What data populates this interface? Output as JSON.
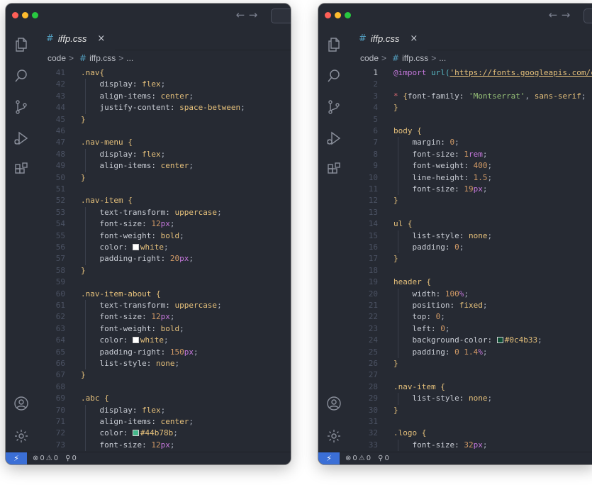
{
  "colors": {
    "window_bg": "#262a33",
    "remote_badge": "#3b6fd6",
    "selector": "#e5c07b",
    "number": "#d19a66",
    "unit": "#c678dd",
    "line_number": "#4b5263"
  },
  "nav": {
    "back": "←",
    "forward": "→"
  },
  "tab": {
    "icon": "#",
    "name": "iffp.css",
    "close": "×"
  },
  "breadcrumb": {
    "folder": "code",
    "sep": ">",
    "icon": "#",
    "file": "iffp.css",
    "tail": "..."
  },
  "activity_bar": [
    "explorer-icon",
    "search-icon",
    "source-control-icon",
    "run-debug-icon",
    "extensions-icon",
    "account-icon",
    "settings-gear-icon"
  ],
  "status": {
    "remote": "⚡",
    "errors_icon": "⊗",
    "errors": "0",
    "warnings_icon": "⚠",
    "warnings": "0",
    "ports_icon": "⚲",
    "ports": "0"
  },
  "windows": [
    {
      "lines": [
        {
          "n": "41",
          "t": [
            [
              "sel",
              ".nav{"
            ]
          ]
        },
        {
          "n": "42",
          "t": [
            [
              "prop",
              "    display: "
            ],
            [
              "val",
              "flex"
            ],
            [
              "punc",
              ";"
            ]
          ]
        },
        {
          "n": "43",
          "t": [
            [
              "prop",
              "    align-items: "
            ],
            [
              "val",
              "center"
            ],
            [
              "punc",
              ";"
            ]
          ]
        },
        {
          "n": "44",
          "t": [
            [
              "prop",
              "    justify-content: "
            ],
            [
              "val",
              "space-between"
            ],
            [
              "punc",
              ";"
            ]
          ]
        },
        {
          "n": "45",
          "t": [
            [
              "sel",
              "}"
            ]
          ]
        },
        {
          "n": "46",
          "t": []
        },
        {
          "n": "47",
          "t": [
            [
              "sel",
              ".nav-menu {"
            ]
          ]
        },
        {
          "n": "48",
          "t": [
            [
              "prop",
              "    display: "
            ],
            [
              "val",
              "flex"
            ],
            [
              "punc",
              ";"
            ]
          ]
        },
        {
          "n": "49",
          "t": [
            [
              "prop",
              "    align-items: "
            ],
            [
              "val",
              "center"
            ],
            [
              "punc",
              ";"
            ]
          ]
        },
        {
          "n": "50",
          "t": [
            [
              "sel",
              "}"
            ]
          ]
        },
        {
          "n": "51",
          "t": []
        },
        {
          "n": "52",
          "t": [
            [
              "sel",
              ".nav-item {"
            ]
          ]
        },
        {
          "n": "53",
          "t": [
            [
              "prop",
              "    text-transform: "
            ],
            [
              "val",
              "uppercase"
            ],
            [
              "punc",
              ";"
            ]
          ]
        },
        {
          "n": "54",
          "t": [
            [
              "prop",
              "    font-size: "
            ],
            [
              "num",
              "12"
            ],
            [
              "unit",
              "px"
            ],
            [
              "punc",
              ";"
            ]
          ]
        },
        {
          "n": "55",
          "t": [
            [
              "prop",
              "    font-weight: "
            ],
            [
              "val",
              "bold"
            ],
            [
              "punc",
              ";"
            ]
          ]
        },
        {
          "n": "56",
          "t": [
            [
              "prop",
              "    color: "
            ],
            [
              "swatch",
              "#ffffff"
            ],
            [
              "val",
              "white"
            ],
            [
              "punc",
              ";"
            ]
          ]
        },
        {
          "n": "57",
          "t": [
            [
              "prop",
              "    padding-right: "
            ],
            [
              "num",
              "20"
            ],
            [
              "unit",
              "px"
            ],
            [
              "punc",
              ";"
            ]
          ]
        },
        {
          "n": "58",
          "t": [
            [
              "sel",
              "}"
            ]
          ]
        },
        {
          "n": "59",
          "t": []
        },
        {
          "n": "60",
          "t": [
            [
              "sel",
              ".nav-item-about {"
            ]
          ]
        },
        {
          "n": "61",
          "t": [
            [
              "prop",
              "    text-transform: "
            ],
            [
              "val",
              "uppercase"
            ],
            [
              "punc",
              ";"
            ]
          ]
        },
        {
          "n": "62",
          "t": [
            [
              "prop",
              "    font-size: "
            ],
            [
              "num",
              "12"
            ],
            [
              "unit",
              "px"
            ],
            [
              "punc",
              ";"
            ]
          ]
        },
        {
          "n": "63",
          "t": [
            [
              "prop",
              "    font-weight: "
            ],
            [
              "val",
              "bold"
            ],
            [
              "punc",
              ";"
            ]
          ]
        },
        {
          "n": "64",
          "t": [
            [
              "prop",
              "    color: "
            ],
            [
              "swatch",
              "#ffffff"
            ],
            [
              "val",
              "white"
            ],
            [
              "punc",
              ";"
            ]
          ]
        },
        {
          "n": "65",
          "t": [
            [
              "prop",
              "    padding-right: "
            ],
            [
              "num",
              "150"
            ],
            [
              "unit",
              "px"
            ],
            [
              "punc",
              ";"
            ]
          ]
        },
        {
          "n": "66",
          "t": [
            [
              "prop",
              "    list-style: "
            ],
            [
              "val",
              "none"
            ],
            [
              "punc",
              ";"
            ]
          ]
        },
        {
          "n": "67",
          "t": [
            [
              "sel",
              "}"
            ]
          ]
        },
        {
          "n": "68",
          "t": []
        },
        {
          "n": "69",
          "t": [
            [
              "sel",
              ".abc {"
            ]
          ]
        },
        {
          "n": "70",
          "t": [
            [
              "prop",
              "    display: "
            ],
            [
              "val",
              "flex"
            ],
            [
              "punc",
              ";"
            ]
          ]
        },
        {
          "n": "71",
          "t": [
            [
              "prop",
              "    align-items: "
            ],
            [
              "val",
              "center"
            ],
            [
              "punc",
              ";"
            ]
          ]
        },
        {
          "n": "72",
          "t": [
            [
              "prop",
              "    color: "
            ],
            [
              "swatch",
              "#44b78b"
            ],
            [
              "val",
              "#44b78b"
            ],
            [
              "punc",
              ";"
            ]
          ]
        },
        {
          "n": "73",
          "t": [
            [
              "prop",
              "    font-size: "
            ],
            [
              "num",
              "12"
            ],
            [
              "unit",
              "px"
            ],
            [
              "punc",
              ";"
            ]
          ]
        }
      ]
    },
    {
      "lines": [
        {
          "n": "1",
          "active": true,
          "t": [
            [
              "at",
              "@import "
            ],
            [
              "fn",
              "url("
            ],
            [
              "url",
              "'https://fonts.googleapis.com/c"
            ]
          ]
        },
        {
          "n": "2",
          "t": []
        },
        {
          "n": "3",
          "t": [
            [
              "star",
              "* "
            ],
            [
              "sel",
              "{"
            ],
            [
              "prop",
              "font-family: "
            ],
            [
              "str",
              "'Montserrat'"
            ],
            [
              "punc",
              ", "
            ],
            [
              "val",
              "sans-serif"
            ],
            [
              "punc",
              ";"
            ]
          ]
        },
        {
          "n": "4",
          "t": [
            [
              "sel",
              "}"
            ]
          ]
        },
        {
          "n": "5",
          "t": []
        },
        {
          "n": "6",
          "t": [
            [
              "sel",
              "body {"
            ]
          ]
        },
        {
          "n": "7",
          "t": [
            [
              "prop",
              "    margin: "
            ],
            [
              "num",
              "0"
            ],
            [
              "punc",
              ";"
            ]
          ]
        },
        {
          "n": "8",
          "t": [
            [
              "prop",
              "    font-size: "
            ],
            [
              "num",
              "1"
            ],
            [
              "unit",
              "rem"
            ],
            [
              "punc",
              ";"
            ]
          ]
        },
        {
          "n": "9",
          "t": [
            [
              "prop",
              "    font-weight: "
            ],
            [
              "num",
              "400"
            ],
            [
              "punc",
              ";"
            ]
          ]
        },
        {
          "n": "10",
          "t": [
            [
              "prop",
              "    line-height: "
            ],
            [
              "num",
              "1.5"
            ],
            [
              "punc",
              ";"
            ]
          ]
        },
        {
          "n": "11",
          "t": [
            [
              "prop",
              "    font-size: "
            ],
            [
              "num",
              "19"
            ],
            [
              "unit",
              "px"
            ],
            [
              "punc",
              ";"
            ]
          ]
        },
        {
          "n": "12",
          "t": [
            [
              "sel",
              "}"
            ]
          ]
        },
        {
          "n": "13",
          "t": []
        },
        {
          "n": "14",
          "t": [
            [
              "sel",
              "ul {"
            ]
          ]
        },
        {
          "n": "15",
          "t": [
            [
              "prop",
              "    list-style: "
            ],
            [
              "val",
              "none"
            ],
            [
              "punc",
              ";"
            ]
          ]
        },
        {
          "n": "16",
          "t": [
            [
              "prop",
              "    padding: "
            ],
            [
              "num",
              "0"
            ],
            [
              "punc",
              ";"
            ]
          ]
        },
        {
          "n": "17",
          "t": [
            [
              "sel",
              "}"
            ]
          ]
        },
        {
          "n": "18",
          "t": []
        },
        {
          "n": "19",
          "t": [
            [
              "sel",
              "header {"
            ]
          ]
        },
        {
          "n": "20",
          "t": [
            [
              "prop",
              "    width: "
            ],
            [
              "num",
              "100"
            ],
            [
              "unit",
              "%"
            ],
            [
              "punc",
              ";"
            ]
          ]
        },
        {
          "n": "21",
          "t": [
            [
              "prop",
              "    position: "
            ],
            [
              "val",
              "fixed"
            ],
            [
              "punc",
              ";"
            ]
          ]
        },
        {
          "n": "22",
          "t": [
            [
              "prop",
              "    top: "
            ],
            [
              "num",
              "0"
            ],
            [
              "punc",
              ";"
            ]
          ]
        },
        {
          "n": "23",
          "t": [
            [
              "prop",
              "    left: "
            ],
            [
              "num",
              "0"
            ],
            [
              "punc",
              ";"
            ]
          ]
        },
        {
          "n": "24",
          "t": [
            [
              "prop",
              "    background-color: "
            ],
            [
              "swatch",
              "#0c4b33"
            ],
            [
              "val",
              "#0c4b33"
            ],
            [
              "punc",
              ";"
            ]
          ]
        },
        {
          "n": "25",
          "t": [
            [
              "prop",
              "    padding: "
            ],
            [
              "num",
              "0 1.4"
            ],
            [
              "unit",
              "%"
            ],
            [
              "punc",
              ";"
            ]
          ]
        },
        {
          "n": "26",
          "t": [
            [
              "sel",
              "}"
            ]
          ]
        },
        {
          "n": "27",
          "t": []
        },
        {
          "n": "28",
          "t": [
            [
              "sel",
              ".nav-item {"
            ]
          ]
        },
        {
          "n": "29",
          "t": [
            [
              "prop",
              "    list-style: "
            ],
            [
              "val",
              "none"
            ],
            [
              "punc",
              ";"
            ]
          ]
        },
        {
          "n": "30",
          "t": [
            [
              "sel",
              "}"
            ]
          ]
        },
        {
          "n": "31",
          "t": []
        },
        {
          "n": "32",
          "t": [
            [
              "sel",
              ".logo {"
            ]
          ]
        },
        {
          "n": "33",
          "t": [
            [
              "prop",
              "    font-size: "
            ],
            [
              "num",
              "32"
            ],
            [
              "unit",
              "px"
            ],
            [
              "punc",
              ";"
            ]
          ]
        }
      ]
    }
  ]
}
